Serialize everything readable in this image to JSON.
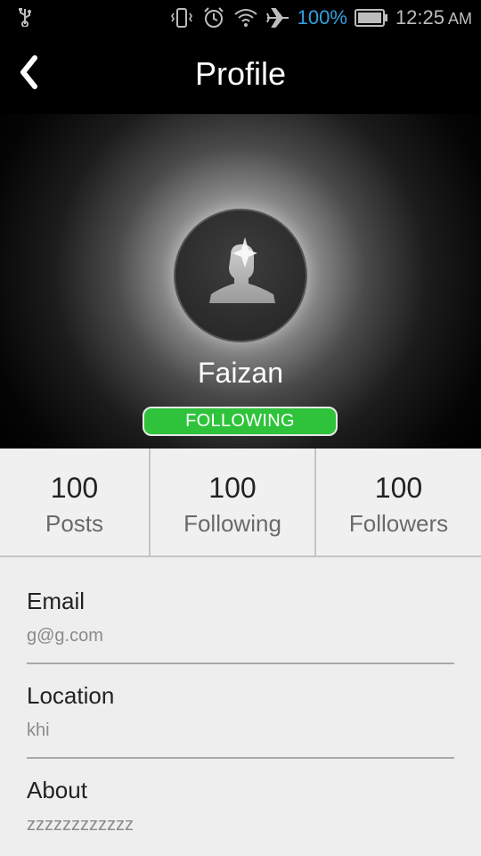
{
  "status_bar": {
    "icons": [
      "usb-icon",
      "vibrate-icon",
      "alarm-icon",
      "wifi-icon",
      "airplane-icon",
      "battery-icon"
    ],
    "battery_percent": "100%",
    "time": "12:25",
    "ampm": "AM",
    "battery_color": "#33a1e0"
  },
  "header": {
    "title": "Profile",
    "back_icon": "chevron-left-icon"
  },
  "profile": {
    "name": "Faizan",
    "follow_status": "FOLLOWING",
    "follow_color": "#2fc33b",
    "avatar_icon": "user-silhouette-icon"
  },
  "stats": [
    {
      "value": "100",
      "label": "Posts"
    },
    {
      "value": "100",
      "label": "Following"
    },
    {
      "value": "100",
      "label": "Followers"
    }
  ],
  "fields": [
    {
      "label": "Email",
      "value": "g@g.com"
    },
    {
      "label": "Location",
      "value": "khi"
    },
    {
      "label": "About",
      "value": "zzzzzzzzzzzz"
    }
  ]
}
